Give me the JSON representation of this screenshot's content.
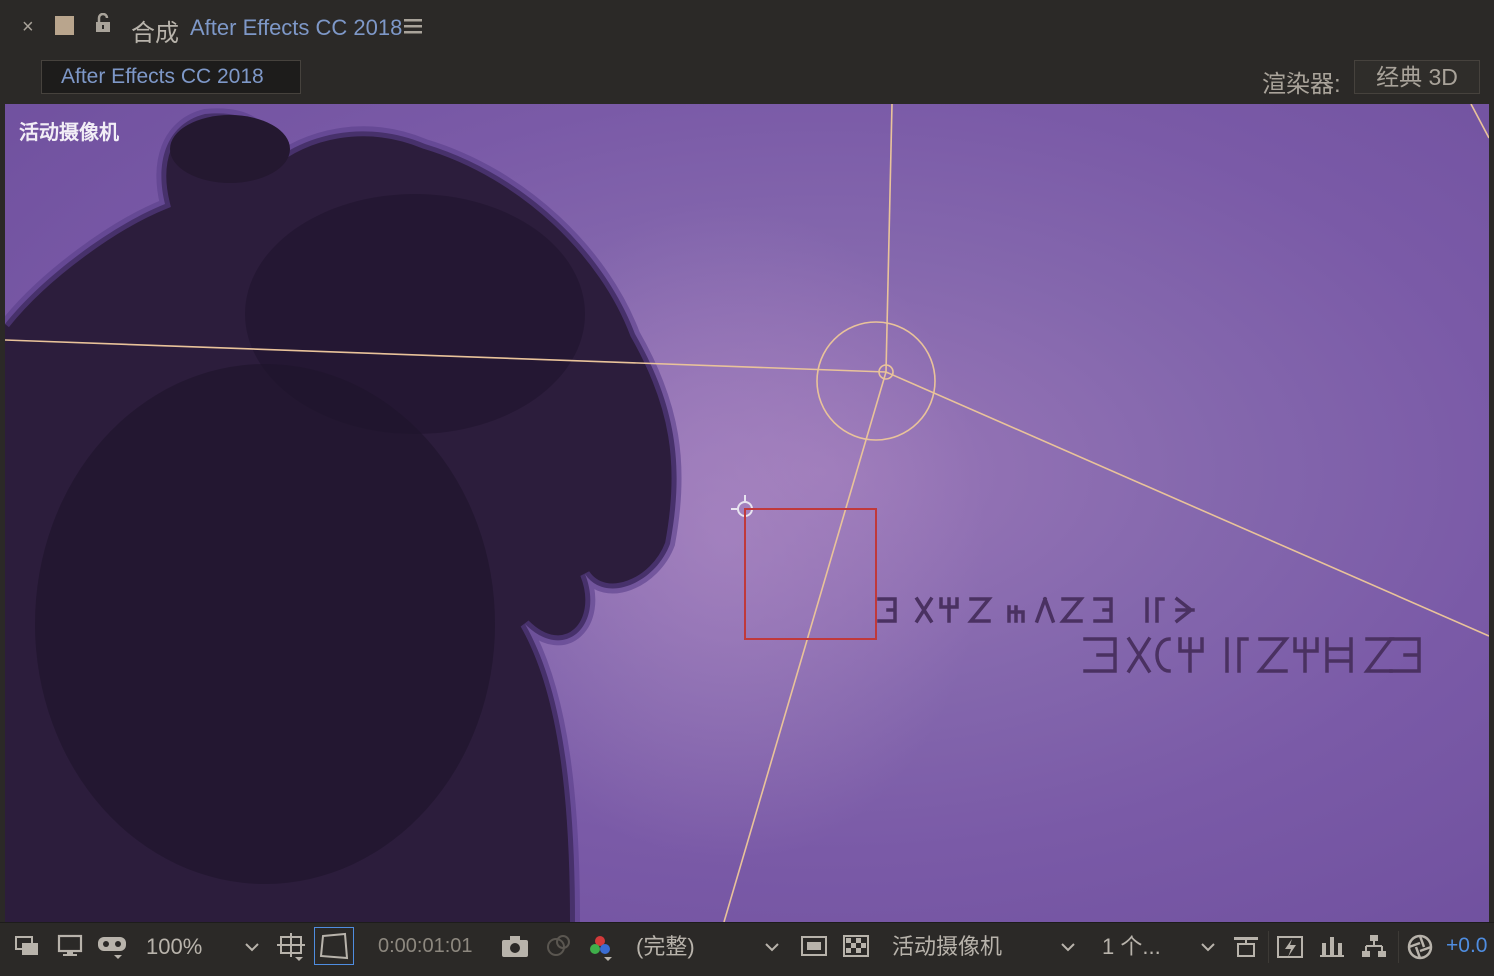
{
  "title_bar": {
    "close": "×",
    "comp_prefix": "合成",
    "comp_name": "After Effects CC 2018"
  },
  "sub_bar": {
    "comp_tab": "After Effects CC 2018",
    "renderer_label": "渲染器:",
    "renderer_value": "经典 3D"
  },
  "viewer": {
    "view_label": "活动摄像机",
    "background_color": "#8467ad",
    "camera_line_color": "#e9c39a",
    "selection_color": "#c0393b"
  },
  "toolbar": {
    "zoom": "100%",
    "timecode": "0:00:01:01",
    "resolution": "(完整)",
    "camera_view": "活动摄像机",
    "views": "1 个...",
    "exposure": "+0.0",
    "accent_color": "#4f8de0"
  }
}
